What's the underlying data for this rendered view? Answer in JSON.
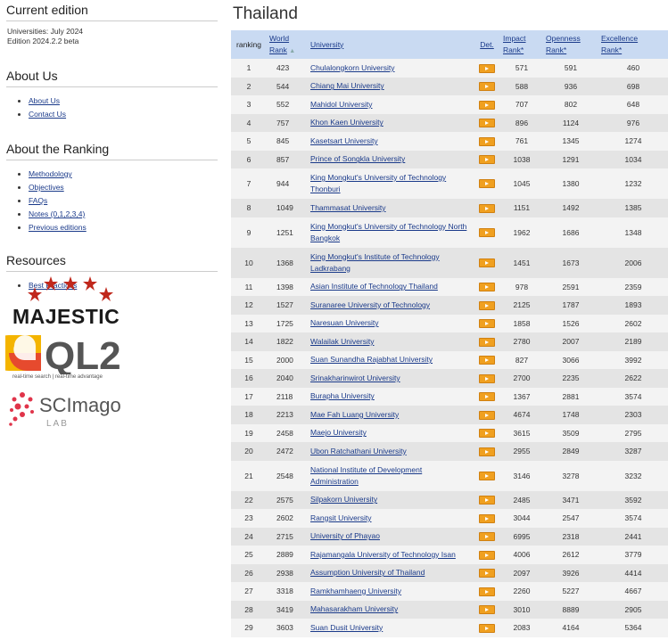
{
  "sidebar": {
    "current_edition": {
      "heading": "Current edition",
      "line1": "Universities: July 2024",
      "line2": "Edition 2024.2.2 beta"
    },
    "about_us": {
      "heading": "About Us",
      "links": [
        "About Us",
        "Contact Us"
      ]
    },
    "about_ranking": {
      "heading": "About the Ranking",
      "links": [
        "Methodology",
        "Objectives",
        "FAQs",
        "Notes (0,1,2,3,4)",
        "Previous editions"
      ]
    },
    "resources": {
      "heading": "Resources",
      "links": [
        "Best Practices"
      ]
    },
    "logos": {
      "majestic": "MAJESTIC",
      "ql2": "QL2",
      "ql2_tagline": "real-time search | real-time advantage",
      "scimago": "SCImago",
      "scimago_lab": "LAB"
    }
  },
  "main": {
    "title": "Thailand",
    "headers": {
      "ranking": "ranking",
      "world_rank_1": "World",
      "world_rank_2": "Rank",
      "university": "University",
      "det": "Det.",
      "impact_1": "Impact",
      "impact_2": "Rank*",
      "openness_1": "Openness",
      "openness_2": "Rank*",
      "excellence_1": "Excellence",
      "excellence_2": "Rank*"
    },
    "rows": [
      {
        "rank": "1",
        "world": "423",
        "name": "Chulalongkorn University",
        "impact": "571",
        "openness": "591",
        "excellence": "460"
      },
      {
        "rank": "2",
        "world": "544",
        "name": "Chiang Mai University",
        "impact": "588",
        "openness": "936",
        "excellence": "698"
      },
      {
        "rank": "3",
        "world": "552",
        "name": "Mahidol University",
        "impact": "707",
        "openness": "802",
        "excellence": "648"
      },
      {
        "rank": "4",
        "world": "757",
        "name": "Khon Kaen University",
        "impact": "896",
        "openness": "1124",
        "excellence": "976"
      },
      {
        "rank": "5",
        "world": "845",
        "name": "Kasetsart University",
        "impact": "761",
        "openness": "1345",
        "excellence": "1274"
      },
      {
        "rank": "6",
        "world": "857",
        "name": "Prince of Songkla University",
        "impact": "1038",
        "openness": "1291",
        "excellence": "1034"
      },
      {
        "rank": "7",
        "world": "944",
        "name": "King Mongkut's University of Technology Thonburi",
        "impact": "1045",
        "openness": "1380",
        "excellence": "1232",
        "tall": true
      },
      {
        "rank": "8",
        "world": "1049",
        "name": "Thammasat University",
        "impact": "1151",
        "openness": "1492",
        "excellence": "1385"
      },
      {
        "rank": "9",
        "world": "1251",
        "name": "King Mongkut's University of Technology North Bangkok",
        "impact": "1962",
        "openness": "1686",
        "excellence": "1348",
        "tall": true
      },
      {
        "rank": "10",
        "world": "1368",
        "name": "King Mongkut's Institute of Technology Ladkrabang",
        "impact": "1451",
        "openness": "1673",
        "excellence": "2006",
        "tall": true
      },
      {
        "rank": "11",
        "world": "1398",
        "name": "Asian Institute of Technology Thailand",
        "impact": "978",
        "openness": "2591",
        "excellence": "2359"
      },
      {
        "rank": "12",
        "world": "1527",
        "name": "Suranaree University of Technology",
        "impact": "2125",
        "openness": "1787",
        "excellence": "1893"
      },
      {
        "rank": "13",
        "world": "1725",
        "name": "Naresuan University",
        "impact": "1858",
        "openness": "1526",
        "excellence": "2602"
      },
      {
        "rank": "14",
        "world": "1822",
        "name": "Walailak University",
        "impact": "2780",
        "openness": "2007",
        "excellence": "2189"
      },
      {
        "rank": "15",
        "world": "2000",
        "name": "Suan Sunandha Rajabhat University",
        "impact": "827",
        "openness": "3066",
        "excellence": "3992"
      },
      {
        "rank": "16",
        "world": "2040",
        "name": "Srinakharinwirot University",
        "impact": "2700",
        "openness": "2235",
        "excellence": "2622"
      },
      {
        "rank": "17",
        "world": "2118",
        "name": "Burapha University",
        "impact": "1367",
        "openness": "2881",
        "excellence": "3574"
      },
      {
        "rank": "18",
        "world": "2213",
        "name": "Mae Fah Luang University",
        "impact": "4674",
        "openness": "1748",
        "excellence": "2303"
      },
      {
        "rank": "19",
        "world": "2458",
        "name": "Maejo University",
        "impact": "3615",
        "openness": "3509",
        "excellence": "2795"
      },
      {
        "rank": "20",
        "world": "2472",
        "name": "Ubon Ratchathani University",
        "impact": "2955",
        "openness": "2849",
        "excellence": "3287"
      },
      {
        "rank": "21",
        "world": "2548",
        "name": "National Institute of Development Administration",
        "impact": "3146",
        "openness": "3278",
        "excellence": "3232",
        "tall": true
      },
      {
        "rank": "22",
        "world": "2575",
        "name": "Silpakorn University",
        "impact": "2485",
        "openness": "3471",
        "excellence": "3592"
      },
      {
        "rank": "23",
        "world": "2602",
        "name": "Rangsit University",
        "impact": "3044",
        "openness": "2547",
        "excellence": "3574"
      },
      {
        "rank": "24",
        "world": "2715",
        "name": "University of Phayao",
        "impact": "6995",
        "openness": "2318",
        "excellence": "2441"
      },
      {
        "rank": "25",
        "world": "2889",
        "name": "Rajamangala University of Technology Isan",
        "impact": "4006",
        "openness": "2612",
        "excellence": "3779"
      },
      {
        "rank": "26",
        "world": "2938",
        "name": "Assumption University of Thailand",
        "impact": "2097",
        "openness": "3926",
        "excellence": "4414"
      },
      {
        "rank": "27",
        "world": "3318",
        "name": "Ramkhamhaeng University",
        "impact": "2260",
        "openness": "5227",
        "excellence": "4667"
      },
      {
        "rank": "28",
        "world": "3419",
        "name": "Mahasarakham University",
        "impact": "3010",
        "openness": "8889",
        "excellence": "2905"
      },
      {
        "rank": "29",
        "world": "3603",
        "name": "Suan Dusit University",
        "impact": "2083",
        "openness": "4164",
        "excellence": "5364"
      }
    ]
  },
  "colors": {
    "header_bg": "#c9daf2",
    "link": "#1a3a8a",
    "det_icon": "#f0a020"
  }
}
